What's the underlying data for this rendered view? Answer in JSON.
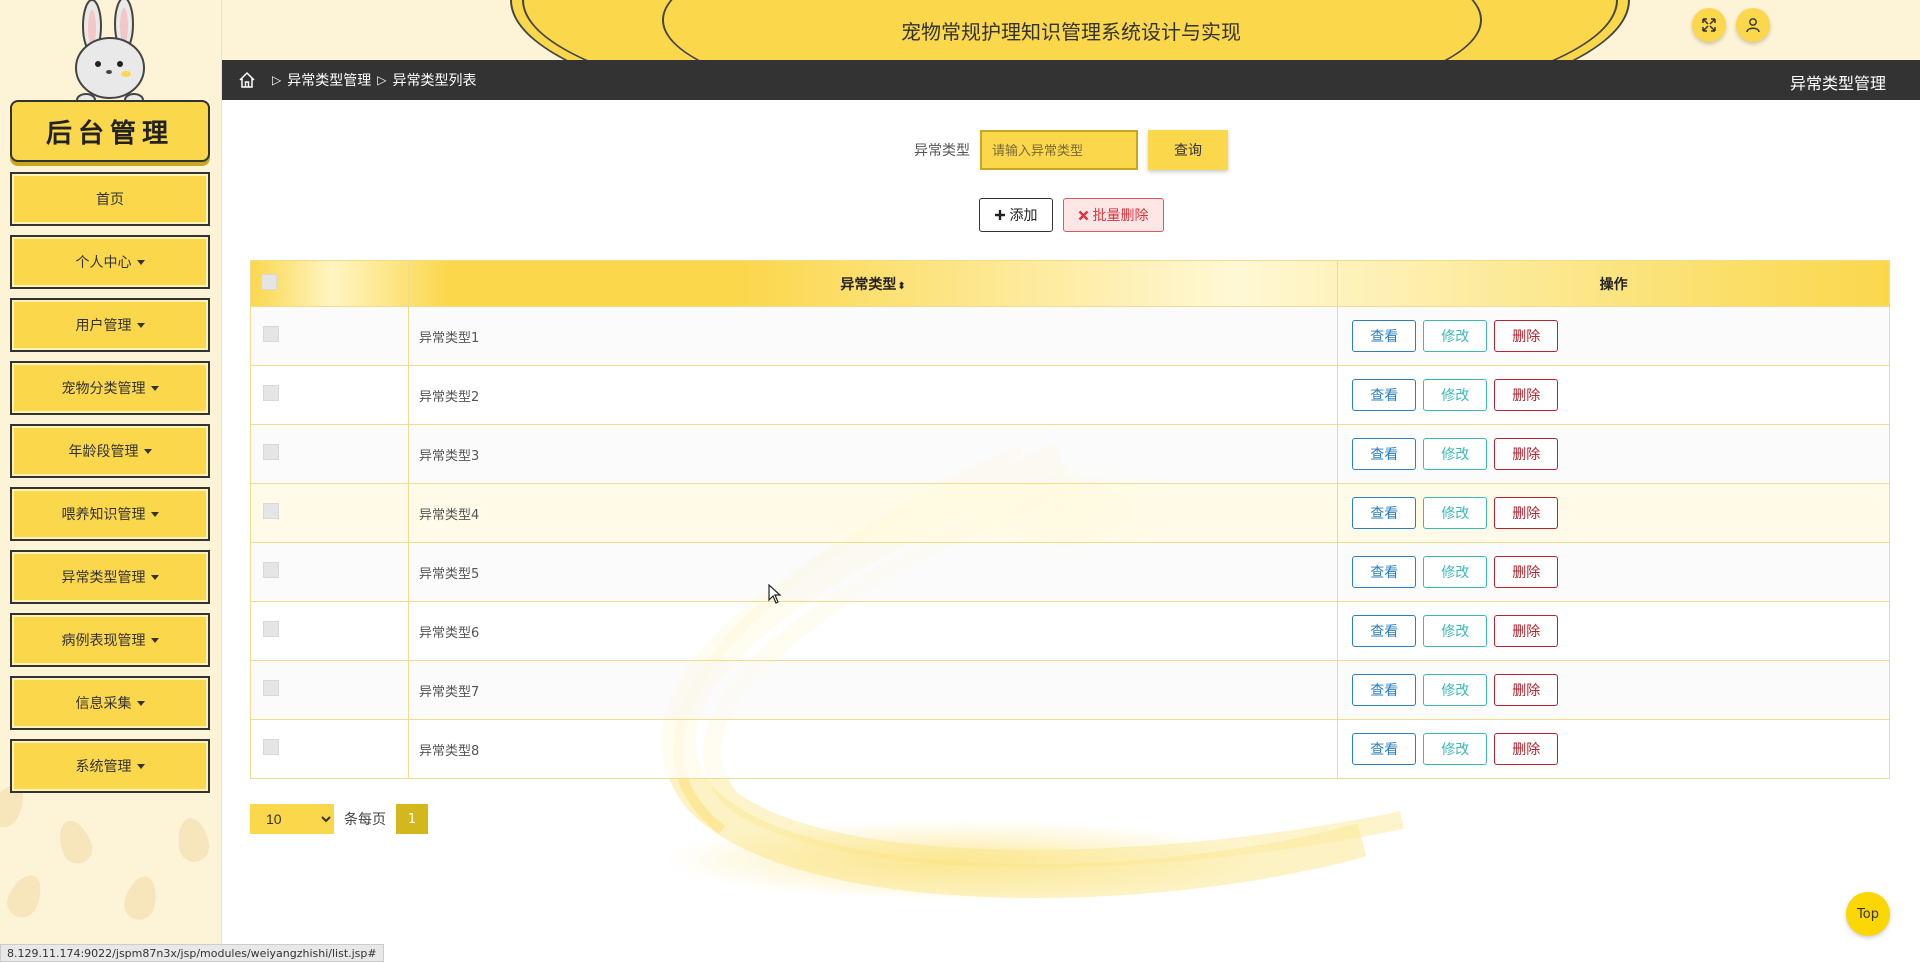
{
  "app": {
    "title": "宠物常规护理知识管理系统设计与实现",
    "brand": "后台管理"
  },
  "sidebar": {
    "items": [
      {
        "label": "首页",
        "dropdown": false
      },
      {
        "label": "个人中心",
        "dropdown": true
      },
      {
        "label": "用户管理",
        "dropdown": true
      },
      {
        "label": "宠物分类管理",
        "dropdown": true
      },
      {
        "label": "年龄段管理",
        "dropdown": true
      },
      {
        "label": "喂养知识管理",
        "dropdown": true
      },
      {
        "label": "异常类型管理",
        "dropdown": true
      },
      {
        "label": "病例表现管理",
        "dropdown": true
      },
      {
        "label": "信息采集",
        "dropdown": true
      },
      {
        "label": "系统管理",
        "dropdown": true
      }
    ]
  },
  "breadcrumb": {
    "items": [
      "异常类型管理",
      "异常类型列表"
    ],
    "section_title": "异常类型管理"
  },
  "search": {
    "label": "异常类型",
    "placeholder": "请输入异常类型",
    "button": "查询"
  },
  "toolbar": {
    "add": "添加",
    "batch_delete": "批量删除"
  },
  "table": {
    "columns": [
      "异常类型",
      "操作"
    ],
    "rows": [
      {
        "name": "异常类型1"
      },
      {
        "name": "异常类型2"
      },
      {
        "name": "异常类型3"
      },
      {
        "name": "异常类型4"
      },
      {
        "name": "异常类型5"
      },
      {
        "name": "异常类型6"
      },
      {
        "name": "异常类型7"
      },
      {
        "name": "异常类型8"
      }
    ],
    "actions": {
      "view": "查看",
      "edit": "修改",
      "delete": "删除"
    }
  },
  "pagination": {
    "page_size": "10",
    "page_size_options": [
      "10"
    ],
    "per_page_label": "条每页",
    "current_page": "1"
  },
  "top_button": "Top",
  "status_url": "8.129.11.174:9022/jspm87n3x/jsp/modules/weiyangzhishi/list.jsp#",
  "colors": {
    "accent": "#fbd74c",
    "dark_bar": "#333333",
    "view": "#2a7fbf",
    "edit": "#3bb9b5",
    "delete": "#b3242e"
  },
  "icons": {
    "home": "home-icon",
    "fullscreen": "fullscreen-icon",
    "user": "user-icon",
    "add": "plus-icon",
    "batch_delete": "close-icon"
  }
}
